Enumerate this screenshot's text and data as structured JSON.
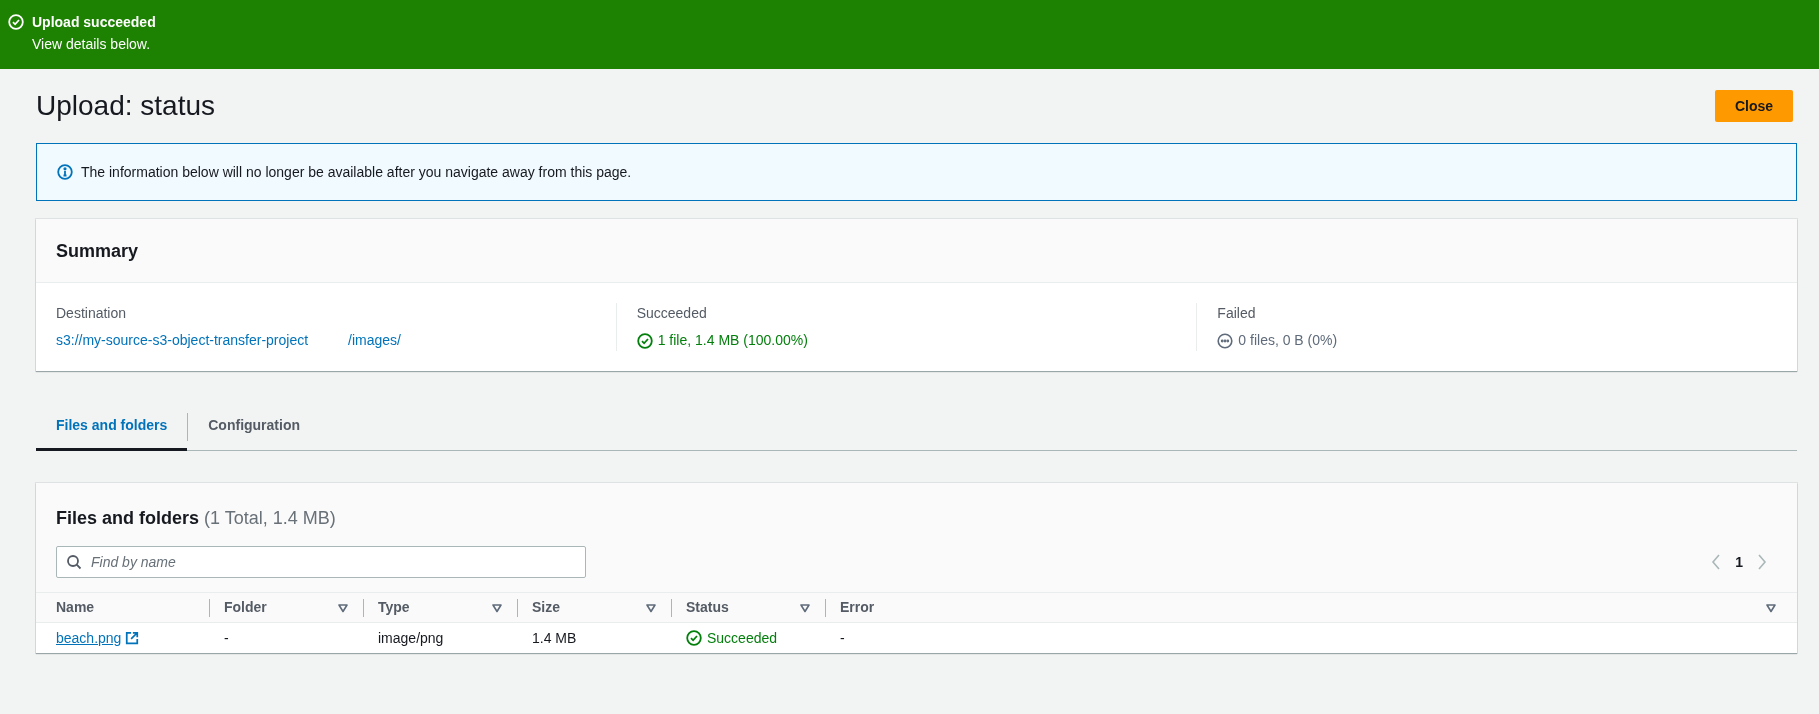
{
  "banner": {
    "kind": "success",
    "title": "Upload succeeded",
    "message": "View details below."
  },
  "page": {
    "title": "Upload: status",
    "close_button": "Close"
  },
  "info_alert": {
    "text": "The information below will no longer be available after you navigate away from this page."
  },
  "summary": {
    "title": "Summary",
    "destination": {
      "label": "Destination",
      "link_start": "s3://my-source-s3-object-transfer-project",
      "link_end": "/images/"
    },
    "stats": [
      {
        "label": "Succeeded",
        "kind": "success",
        "value": "1 file, 1.4 MB (100.00%)"
      },
      {
        "label": "Failed",
        "kind": "neutral",
        "value": "0 files, 0 B (0%)"
      }
    ]
  },
  "tabs": [
    {
      "label": "Files and folders",
      "selected": true
    },
    {
      "label": "Configuration",
      "selected": false
    }
  ],
  "files": {
    "title": "Files and folders",
    "count": "(1 Total, 1.4 MB)",
    "search": {
      "placeholder": "Find by name"
    },
    "pagination": {
      "page": "1"
    },
    "columns": [
      {
        "label": "Name",
        "sortable": false
      },
      {
        "label": "Folder",
        "sortable": true
      },
      {
        "label": "Type",
        "sortable": true
      },
      {
        "label": "Size",
        "sortable": true
      },
      {
        "label": "Status",
        "sortable": true
      },
      {
        "label": "Error",
        "sortable": true
      }
    ],
    "rows": [
      {
        "name": "beach.png",
        "folder": "-",
        "type": "image/png",
        "size": "1.4 MB",
        "kind": "success",
        "status_text": "Succeeded",
        "error": "-"
      }
    ]
  }
}
